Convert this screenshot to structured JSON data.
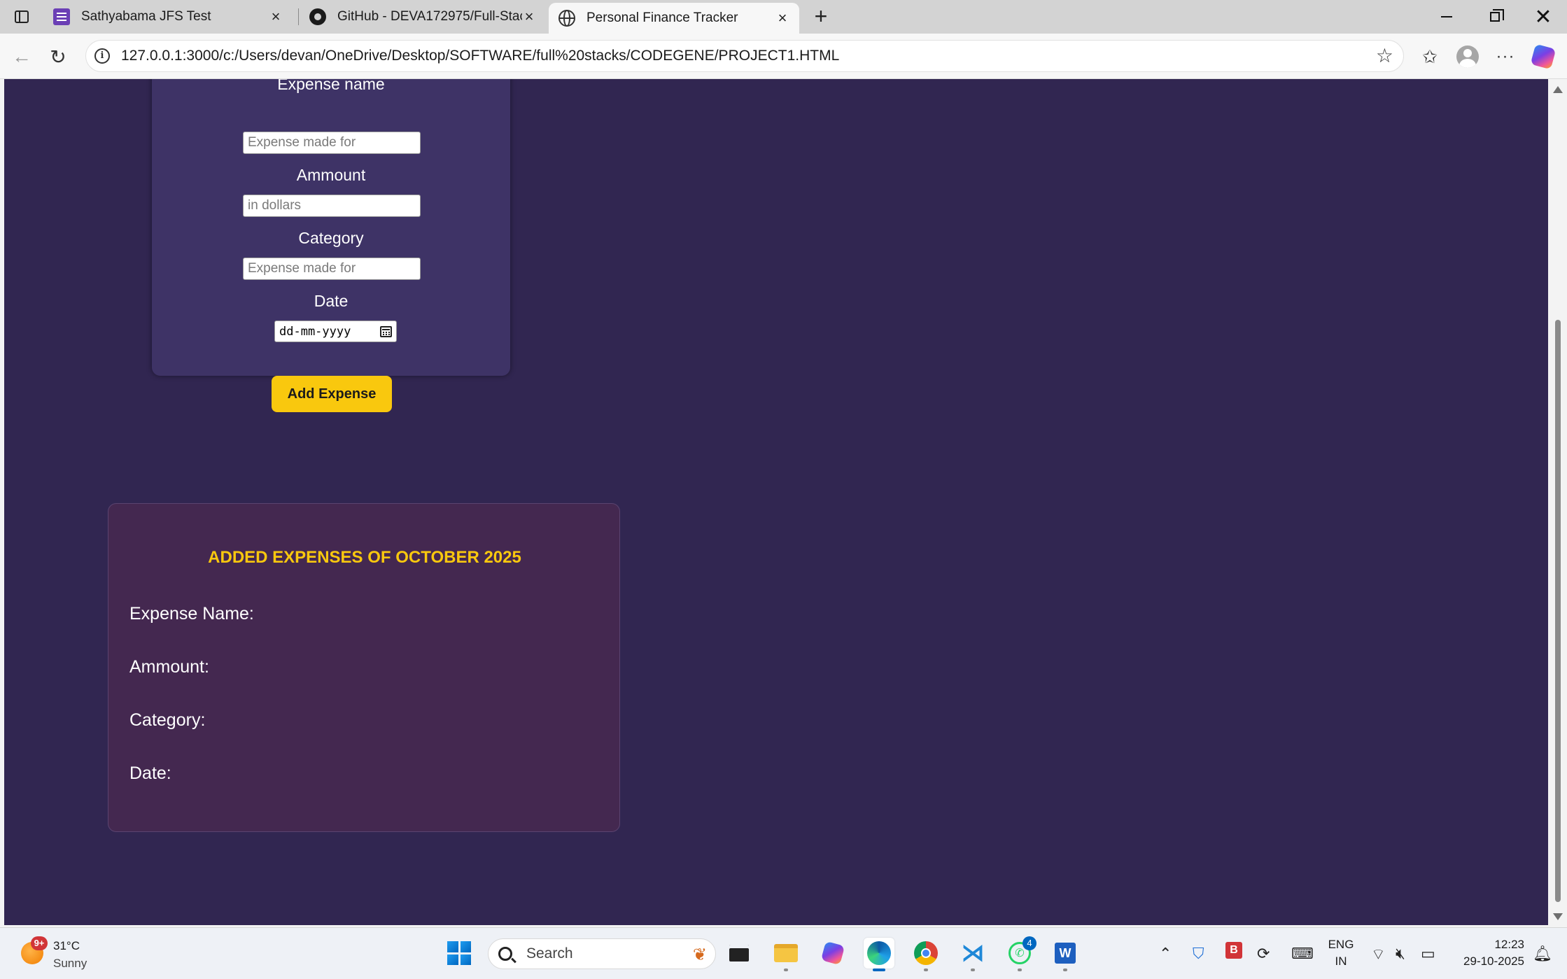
{
  "browser": {
    "tabs": [
      {
        "title": "Sathyabama JFS Test",
        "icon": "forms-icon"
      },
      {
        "title": "GitHub - DEVA172975/Full-Stacks",
        "icon": "github-icon"
      },
      {
        "title": "Personal Finance Tracker",
        "icon": "globe-icon"
      }
    ],
    "active_tab": 2,
    "url": "127.0.0.1:3000/c:/Users/devan/OneDrive/Desktop/SOFTWARE/full%20stacks/CODEGENE/PROJECT1.HTML"
  },
  "form": {
    "name_label": "Expense name",
    "name_placeholder": "Expense made for",
    "amount_label": "Ammount",
    "amount_placeholder": "in dollars",
    "category_label": "Category",
    "category_placeholder": "Expense made for",
    "date_label": "Date",
    "date_placeholder": "dd-mm-yyyy",
    "submit_label": "Add Expense"
  },
  "expenses": {
    "title": "ADDED EXPENSES OF OCTOBER 2025",
    "name_label": "Expense Name:",
    "amount_label": "Ammount:",
    "category_label": "Category:",
    "date_label": "Date:"
  },
  "taskbar": {
    "weather_temp": "31°C",
    "weather_desc": "Sunny",
    "weather_badge": "9+",
    "search_placeholder": "Search",
    "whatsapp_badge": "4",
    "lang_line1": "ENG",
    "lang_line2": "IN",
    "time": "12:23",
    "date": "29-10-2025"
  },
  "colors": {
    "page_bg": "#312651",
    "form_card_bg": "#3e3366",
    "expenses_card_bg": "#442850",
    "accent_yellow": "#f9c80e"
  }
}
